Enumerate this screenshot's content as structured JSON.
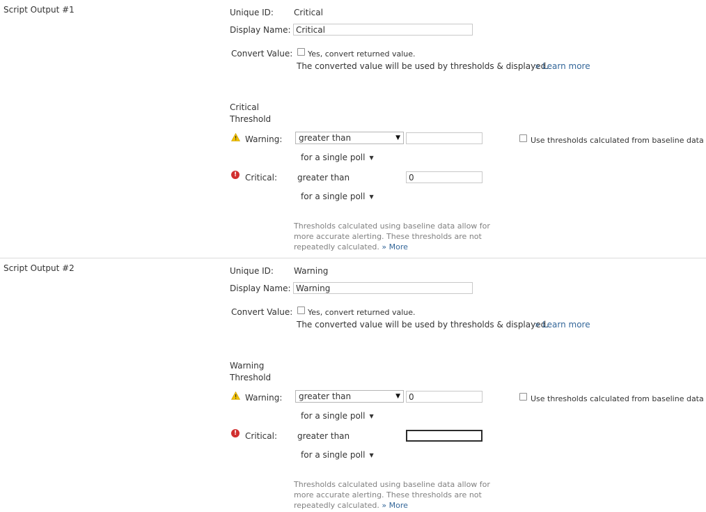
{
  "sections": [
    {
      "title": "Script Output #1",
      "unique_id_label": "Unique ID:",
      "unique_id_value": "Critical",
      "display_name_label": "Display Name:",
      "display_name_value": "Critical",
      "convert_label": "Convert Value:",
      "convert_checkbox_label": "Yes, convert returned value.",
      "convert_help": "The converted value will be used by thresholds & displayed.",
      "learn_more": "» Learn more",
      "threshold_heading_line1": "Critical",
      "threshold_heading_line2": "Threshold",
      "warning_label": "Warning:",
      "warning_operator": "greater than",
      "warning_value": "",
      "warning_poll": "for a single poll",
      "baseline_label": "Use thresholds calculated from baseline data",
      "critical_label": "Critical:",
      "critical_operator": "greater than",
      "critical_value": "0",
      "critical_poll": "for a single poll",
      "note_text": "Thresholds calculated using baseline data allow for more accurate alerting. These thresholds are not repeatedly calculated.",
      "note_more": "» More"
    },
    {
      "title": "Script Output #2",
      "unique_id_label": "Unique ID:",
      "unique_id_value": "Warning",
      "display_name_label": "Display Name:",
      "display_name_value": "Warning",
      "convert_label": "Convert Value:",
      "convert_checkbox_label": "Yes, convert returned value.",
      "convert_help": "The converted value will be used by thresholds & displayed.",
      "learn_more": "» Learn more",
      "threshold_heading_line1": "Warning",
      "threshold_heading_line2": "Threshold",
      "warning_label": "Warning:",
      "warning_operator": "greater than",
      "warning_value": "0",
      "warning_poll": "for a single poll",
      "baseline_label": "Use thresholds calculated from baseline data",
      "critical_label": "Critical:",
      "critical_operator": "greater than",
      "critical_value": "",
      "critical_poll": "for a single poll",
      "note_text": "Thresholds calculated using baseline data allow for more accurate alerting. These thresholds are not repeatedly calculated.",
      "note_more": "» More"
    }
  ],
  "icons": {
    "warning": "warning-triangle-icon",
    "critical": "critical-exclamation-icon",
    "dropdown": "dropdown-arrow-icon"
  },
  "colors": {
    "link": "#336699",
    "warning_icon": "#f2c200",
    "critical_icon": "#d12f2f",
    "note_text": "#808080"
  }
}
